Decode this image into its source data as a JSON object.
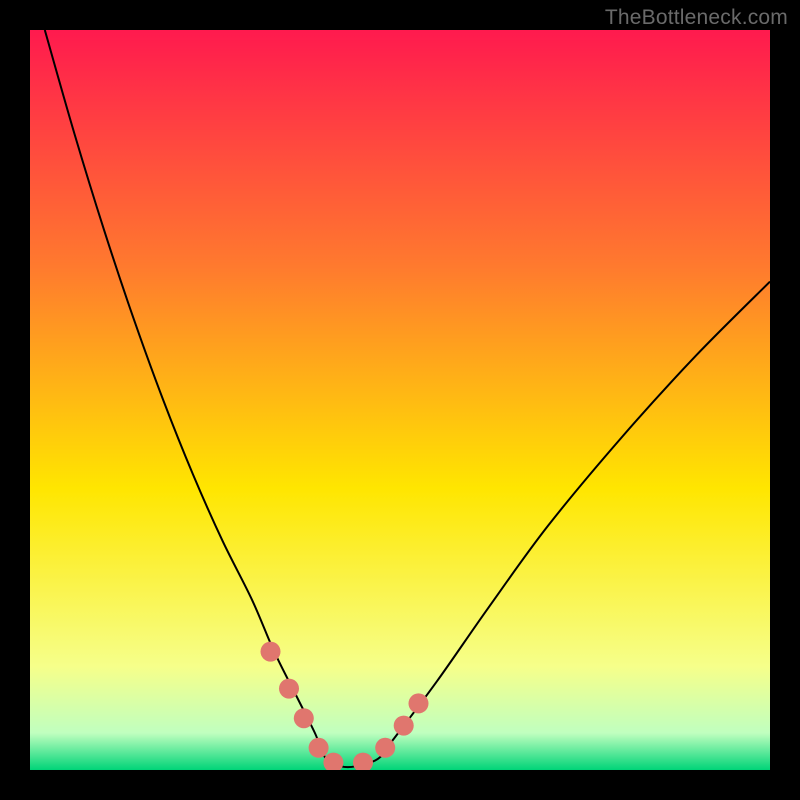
{
  "watermark": "TheBottleneck.com",
  "chart_data": {
    "type": "line",
    "title": "",
    "xlabel": "",
    "ylabel": "",
    "xlim": [
      0,
      100
    ],
    "ylim": [
      0,
      100
    ],
    "grid": false,
    "legend": false,
    "background_gradient": {
      "top_color": "#ff1a4e",
      "upper_mid_color": "#ff7a2e",
      "mid_color": "#ffe600",
      "lower_mid_color": "#f6ff8a",
      "near_bottom_color": "#c0ffbf",
      "bottom_color": "#00d478"
    },
    "series": [
      {
        "name": "bottleneck-curve",
        "x": [
          2,
          6,
          10,
          14,
          18,
          22,
          26,
          30,
          33,
          36,
          38.5,
          40,
          42,
          44,
          47,
          49,
          55,
          62,
          70,
          80,
          90,
          100
        ],
        "y": [
          100,
          86,
          73,
          61,
          50,
          40,
          31,
          23,
          16,
          10,
          5,
          1.5,
          0.5,
          0.5,
          1.5,
          4,
          12,
          22,
          33,
          45,
          56,
          66
        ],
        "color": "#000000",
        "stroke_width": 2
      }
    ],
    "markers": {
      "name": "highlight-points",
      "color": "#e0766e",
      "radius": 10,
      "points": [
        {
          "x": 32.5,
          "y": 16
        },
        {
          "x": 35,
          "y": 11
        },
        {
          "x": 37,
          "y": 7
        },
        {
          "x": 39,
          "y": 3
        },
        {
          "x": 41,
          "y": 1
        },
        {
          "x": 45,
          "y": 1
        },
        {
          "x": 48,
          "y": 3
        },
        {
          "x": 50.5,
          "y": 6
        },
        {
          "x": 52.5,
          "y": 9
        }
      ]
    }
  }
}
